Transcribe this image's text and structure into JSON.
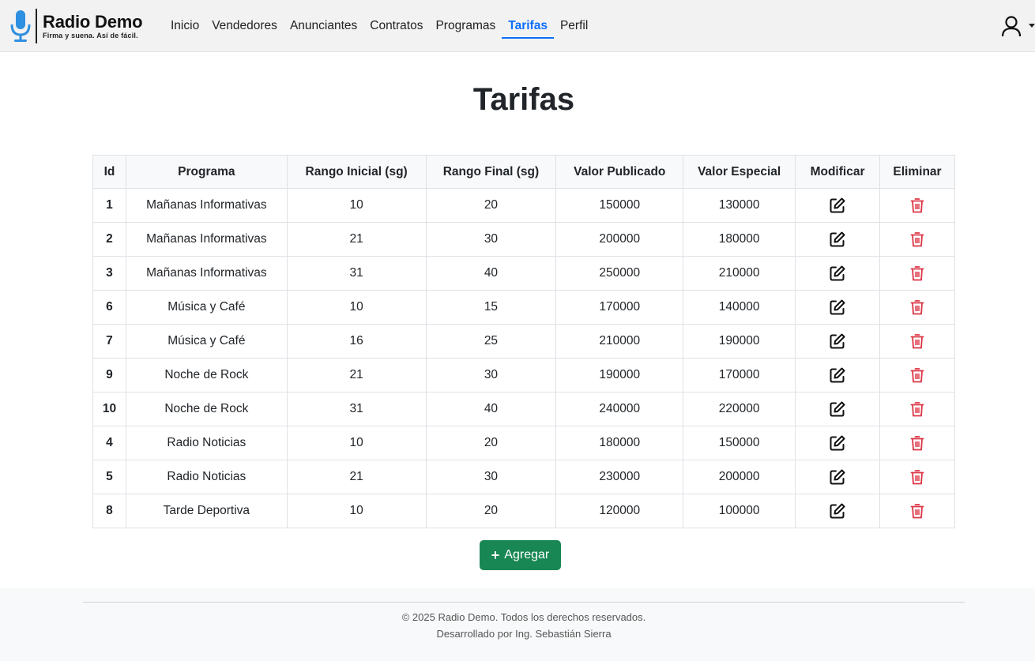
{
  "brand": {
    "title": "Radio Demo",
    "tagline": "Firma y suena. Así de fácil.",
    "accent_color": "#2f8fe0"
  },
  "nav": {
    "links": [
      {
        "label": "Inicio"
      },
      {
        "label": "Vendedores"
      },
      {
        "label": "Anunciantes"
      },
      {
        "label": "Contratos"
      },
      {
        "label": "Programas"
      },
      {
        "label": "Tarifas",
        "active": true
      },
      {
        "label": "Perfil"
      }
    ],
    "active_color": "#0d6efd",
    "user_icon": "person-icon"
  },
  "page": {
    "title": "Tarifas"
  },
  "table": {
    "headers": [
      "Id",
      "Programa",
      "Rango Inicial (sg)",
      "Rango Final (sg)",
      "Valor Publicado",
      "Valor Especial",
      "Modificar",
      "Eliminar"
    ],
    "rows": [
      {
        "id": "1",
        "programa": "Mañanas Informativas",
        "inicial": "10",
        "final": "20",
        "publicado": "150000",
        "especial": "130000"
      },
      {
        "id": "2",
        "programa": "Mañanas Informativas",
        "inicial": "21",
        "final": "30",
        "publicado": "200000",
        "especial": "180000"
      },
      {
        "id": "3",
        "programa": "Mañanas Informativas",
        "inicial": "31",
        "final": "40",
        "publicado": "250000",
        "especial": "210000"
      },
      {
        "id": "6",
        "programa": "Música y Café",
        "inicial": "10",
        "final": "15",
        "publicado": "170000",
        "especial": "140000"
      },
      {
        "id": "7",
        "programa": "Música y Café",
        "inicial": "16",
        "final": "25",
        "publicado": "210000",
        "especial": "190000"
      },
      {
        "id": "9",
        "programa": "Noche de Rock",
        "inicial": "21",
        "final": "30",
        "publicado": "190000",
        "especial": "170000"
      },
      {
        "id": "10",
        "programa": "Noche de Rock",
        "inicial": "31",
        "final": "40",
        "publicado": "240000",
        "especial": "220000"
      },
      {
        "id": "4",
        "programa": "Radio Noticias",
        "inicial": "10",
        "final": "20",
        "publicado": "180000",
        "especial": "150000"
      },
      {
        "id": "5",
        "programa": "Radio Noticias",
        "inicial": "21",
        "final": "30",
        "publicado": "230000",
        "especial": "200000"
      },
      {
        "id": "8",
        "programa": "Tarde Deportiva",
        "inicial": "10",
        "final": "20",
        "publicado": "120000",
        "especial": "100000"
      }
    ],
    "edit_icon": "edit-icon",
    "delete_icon": "trash-icon",
    "delete_color": "#dc3545"
  },
  "actions": {
    "add_label": "Agregar",
    "add_color": "#198754"
  },
  "footer": {
    "copyright": "© 2025 Radio Demo. Todos los derechos reservados.",
    "credit": "Desarrollado por Ing. Sebastián Sierra"
  }
}
